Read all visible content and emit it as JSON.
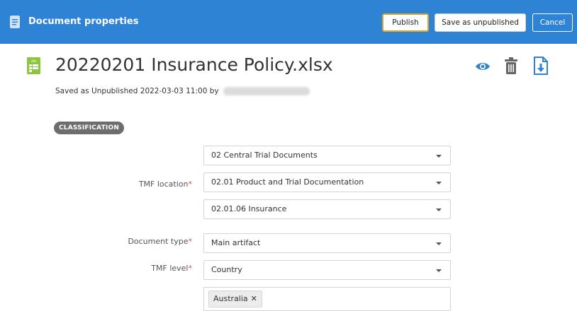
{
  "header": {
    "title": "Document properties",
    "publish_label": "Publish",
    "save_unpublished_label": "Save as unpublished",
    "cancel_label": "Cancel"
  },
  "document": {
    "file_icon": "xlsx-file-icon",
    "icon_text": "xls",
    "filename": "20220201 Insurance Policy.xlsx",
    "saved_text": "Saved as Unpublished 2022-03-03 11:00 by",
    "actions": [
      "eye-icon",
      "trash-icon",
      "download-icon"
    ]
  },
  "classification": {
    "badge": "CLASSIFICATION",
    "tmf_location_label": "TMF location",
    "tmf_location_values": [
      "02 Central Trial Documents",
      "02.01 Product and Trial Documentation",
      "02.01.06 Insurance"
    ],
    "document_type_label": "Document type",
    "document_type_value": "Main artifact",
    "tmf_level_label": "TMF level",
    "tmf_level_value": "Country",
    "country_chip": "Australia",
    "required_marker": "*"
  },
  "colors": {
    "header_bg": "#2f83d4",
    "publish_border": "#e2a42b",
    "required": "#d9534f",
    "icon_blue": "#2f83d4",
    "xlsx_green": "#8cc63f"
  }
}
